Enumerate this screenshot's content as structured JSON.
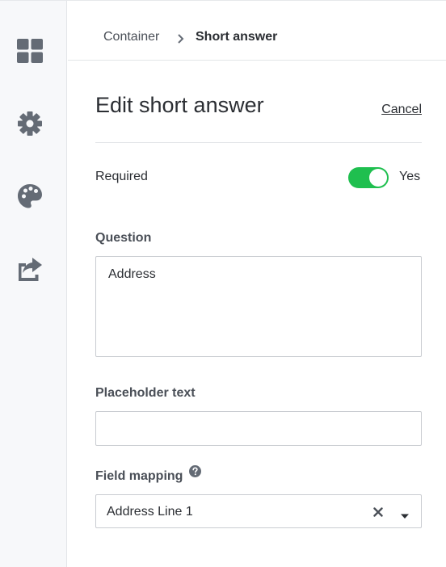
{
  "sidebar": {
    "items": [
      {
        "icon": "dashboard-grid-icon"
      },
      {
        "icon": "gear-icon"
      },
      {
        "icon": "palette-icon"
      },
      {
        "icon": "share-icon"
      }
    ]
  },
  "breadcrumb": {
    "parent": "Container",
    "current": "Short answer"
  },
  "header": {
    "title": "Edit short answer",
    "cancel_label": "Cancel"
  },
  "required": {
    "label": "Required",
    "state_label": "Yes",
    "enabled": true,
    "on_color": "#1fbf4f"
  },
  "question": {
    "label": "Question",
    "value": "Address"
  },
  "placeholder_text": {
    "label": "Placeholder text",
    "value": ""
  },
  "field_mapping": {
    "label": "Field mapping",
    "selected": "Address Line 1",
    "help_icon": "question-circle-icon",
    "clear_icon": "close-icon",
    "dropdown_icon": "caret-down-icon"
  },
  "colors": {
    "sidebar_bg": "#f7f8fa",
    "icon": "#646b75",
    "text": "#2b2e33",
    "border": "#c9ccd1"
  }
}
